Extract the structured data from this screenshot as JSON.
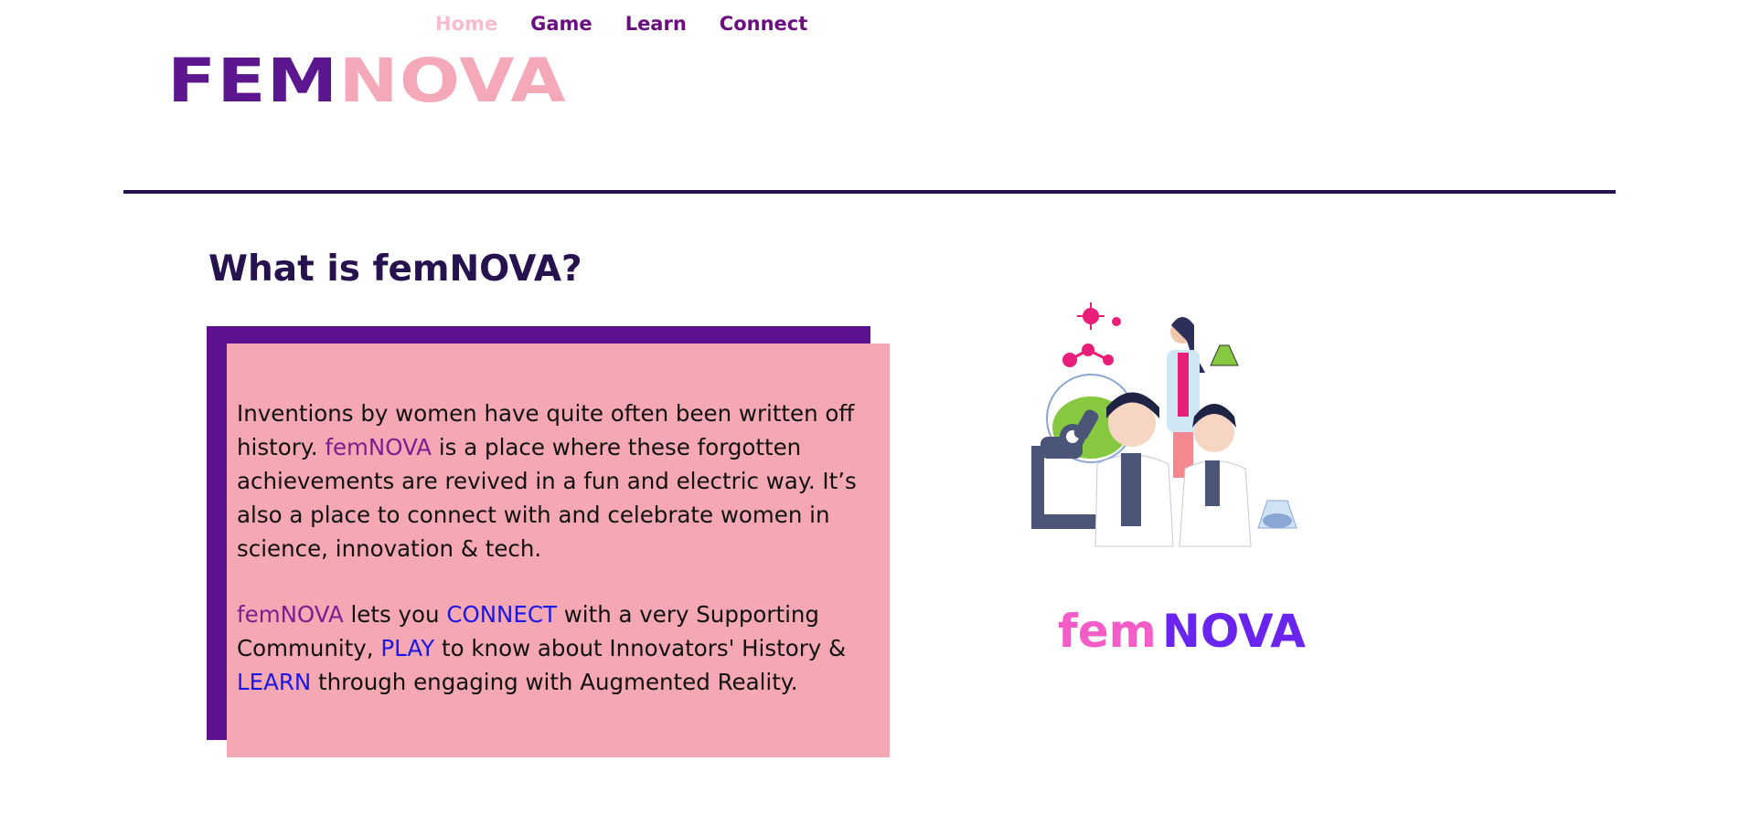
{
  "nav": {
    "items": [
      {
        "label": "Home",
        "active": true
      },
      {
        "label": "Game",
        "active": false
      },
      {
        "label": "Learn",
        "active": false
      },
      {
        "label": "Connect",
        "active": false
      }
    ]
  },
  "logo": {
    "part1": "FEM",
    "part2": "NOVA"
  },
  "main": {
    "heading": "What is femNOVA?",
    "para1": {
      "s1": "Inventions by women have quite often been written off history. ",
      "brand": "femNOVA",
      "s2": " is a place where these forgotten achievements are revived in a fun and electric way. It’s also a place to connect with and celebrate women in science, innovation & tech."
    },
    "para2": {
      "brand": "femNOVA",
      "t1": " lets you ",
      "connect": "CONNECT",
      "t2": " with a very Supporting Community, ",
      "play": "PLAY",
      "t3": " to know about Innovators' History & ",
      "learn": "LEARN",
      "t4": " through engaging with Augmented Reality."
    }
  },
  "illustration": {
    "word1": "fem",
    "word2": "NOVA"
  },
  "colors": {
    "nav_link": "#6b0f80",
    "nav_active": "#f9bccf",
    "logo_purple": "#5c178f",
    "logo_pink": "#f5a8b7",
    "heading": "#26124f",
    "card_back": "#5c1190",
    "card_front": "#f5a8b3",
    "action_link": "#1a17e6"
  }
}
